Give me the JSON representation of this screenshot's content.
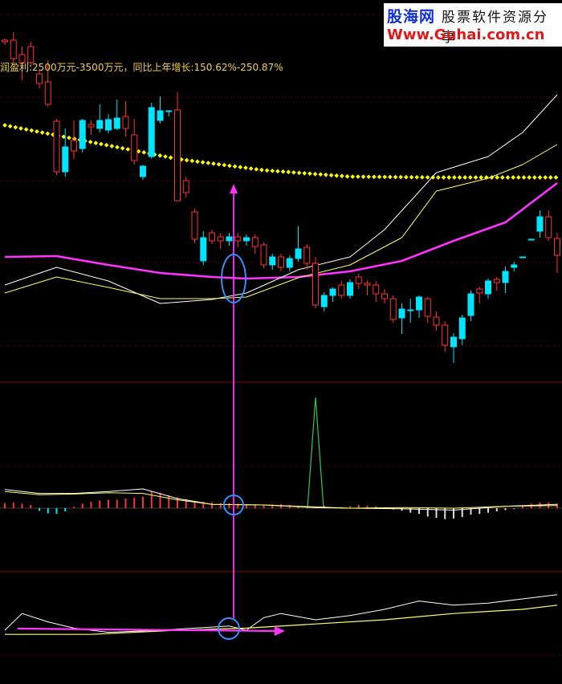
{
  "watermark": {
    "site_name": "股海网",
    "tagline": "股票软件资源分享",
    "url": "Www.Guhai.com.cn"
  },
  "info_text": "润盈利:2500万元-3500万元，同比上年增长:150.62%-250.87%",
  "colors": {
    "background": "#000000",
    "up_candle": "#ff3232",
    "down_candle": "#00e5ff",
    "ma_magenta": "#ff32ff",
    "ma_white": "#ffffff",
    "ma_yellow": "#ffff64",
    "dotted_line": "#ffff00",
    "annotation": "#ff32ff",
    "circle": "#3c8cff",
    "grid": "#8c0000"
  },
  "chart_data": [
    {
      "type": "candlestick",
      "panel": "price",
      "candles": [
        [
          0,
          318,
          297,
          290,
          340
        ],
        [
          1,
          296,
          270,
          262,
          300
        ],
        [
          2,
          270,
          288,
          262,
          296
        ],
        [
          3,
          298,
          298,
          298,
          298
        ],
        [
          4,
          320,
          320,
          320,
          320
        ],
        [
          5,
          330,
          333,
          326,
          338
        ],
        [
          6,
          338,
          352,
          332,
          365
        ],
        [
          7,
          352,
          348,
          345,
          362
        ],
        [
          8,
          350,
          366,
          347,
          372
        ],
        [
          9,
          365,
          360,
          357,
          378
        ],
        [
          10,
          366,
          393,
          362,
          400
        ],
        [
          11,
          396,
          422,
          392,
          430
        ],
        [
          12,
          420,
          432,
          415,
          452
        ],
        [
          13,
          430,
          405,
          400,
          438
        ],
        [
          14,
          405,
          395,
          388,
          412
        ],
        [
          15,
          394,
          372,
          370,
          402
        ],
        [
          16,
          370,
          386,
          368,
          396
        ],
        [
          17,
          386,
          386,
          372,
          402
        ],
        [
          18,
          385,
          396,
          378,
          416
        ],
        [
          19,
          398,
          372,
          368,
          402
        ],
        [
          20,
          372,
          366,
          360,
          378
        ],
        [
          21,
          366,
          355,
          350,
          376
        ],
        [
          22,
          355,
          353,
          349,
          368
        ],
        [
          23,
          353,
          345,
          341,
          360
        ],
        [
          24,
          352,
          368,
          348,
          372
        ],
        [
          25,
          368,
          355,
          350,
          372
        ],
        [
          26,
          360,
          368,
          358,
          376
        ],
        [
          27,
          368,
          382,
          364,
          388
        ],
        [
          28,
          380,
          328,
          320,
          384
        ],
        [
          29,
          328,
          308,
          304,
          336
        ],
        [
          30,
          310,
          322,
          282,
          326
        ],
        [
          31,
          322,
          333,
          318,
          338
        ],
        [
          32,
          333,
          320,
          316,
          338
        ],
        [
          33,
          320,
          330,
          316,
          336
        ],
        [
          34,
          330,
          305,
          302,
          334
        ],
        [
          35,
          307,
          296,
          292,
          316
        ],
        [
          36,
          296,
          300,
          292,
          306
        ],
        [
          37,
          300,
          295,
          290,
          308
        ],
        [
          38,
          295,
          300,
          290,
          306
        ],
        [
          39,
          300,
          295,
          290,
          310
        ],
        [
          40,
          300,
          290,
          286,
          304
        ],
        [
          41,
          296,
          325,
          288,
          330
        ],
        [
          42,
          298,
          264,
          260,
          303
        ],
        [
          43,
          240,
          225,
          220,
          246
        ],
        [
          44,
          250,
          137,
          115,
          150
        ],
        [
          45,
          138,
          138,
          138,
          145
        ],
        [
          46,
          138,
          150,
          120,
          154
        ],
        [
          47,
          134,
          195,
          128,
          198
        ],
        [
          48,
          207,
          220,
          205,
          224
        ],
        [
          49,
          200,
          168,
          148,
          205
        ],
        [
          50,
          160,
          145,
          126,
          170
        ],
        [
          51,
          147,
          160,
          124,
          162
        ],
        [
          52,
          149,
          162,
          142,
          166
        ],
        [
          53,
          150,
          160,
          130,
          165
        ],
        [
          54,
          158,
          155,
          150,
          168
        ],
        [
          55,
          150,
          185,
          148,
          190
        ],
        [
          56,
          188,
          175,
          150,
          198
        ],
        [
          57,
          183,
          214,
          160,
          220
        ],
        [
          58,
          214,
          151,
          148,
          218
        ],
        [
          59,
          130,
          102,
          75,
          133
        ],
        [
          60,
          104,
          92,
          87,
          110
        ],
        [
          61,
          78,
          58,
          52,
          82
        ],
        [
          62,
          78,
          68,
          58,
          100
        ],
        [
          63,
          73,
          50,
          40,
          78
        ],
        [
          64,
          52,
          50,
          48,
          56
        ]
      ],
      "ma_magenta": [
        [
          0,
          320
        ],
        [
          6,
          319
        ],
        [
          12,
          330
        ],
        [
          18,
          340
        ],
        [
          24,
          345
        ],
        [
          28,
          347
        ],
        [
          34,
          345
        ],
        [
          40,
          338
        ],
        [
          46,
          325
        ],
        [
          52,
          300
        ],
        [
          58,
          277
        ],
        [
          64,
          228
        ]
      ],
      "ma_white": [
        [
          0,
          355
        ],
        [
          6,
          333
        ],
        [
          12,
          350
        ],
        [
          18,
          378
        ],
        [
          24,
          373
        ],
        [
          28,
          365
        ],
        [
          34,
          336
        ],
        [
          40,
          320
        ],
        [
          44,
          286
        ],
        [
          50,
          215
        ],
        [
          56,
          195
        ],
        [
          60,
          165
        ],
        [
          64,
          118
        ]
      ],
      "ma_yellow": [
        [
          0,
          365
        ],
        [
          6,
          345
        ],
        [
          12,
          358
        ],
        [
          18,
          372
        ],
        [
          24,
          372
        ],
        [
          28,
          370
        ],
        [
          34,
          346
        ],
        [
          40,
          330
        ],
        [
          46,
          296
        ],
        [
          50,
          238
        ],
        [
          56,
          222
        ],
        [
          60,
          205
        ],
        [
          64,
          180
        ]
      ],
      "dotted": [
        [
          0,
          156
        ],
        [
          10,
          177
        ],
        [
          20,
          198
        ],
        [
          30,
          212
        ],
        [
          40,
          220
        ],
        [
          50,
          221
        ],
        [
          60,
          221
        ],
        [
          64,
          221
        ]
      ]
    },
    {
      "type": "bar",
      "panel": "macd",
      "histogram": [
        0.7,
        0.9,
        0.9,
        0.7,
        0.4,
        -0.1,
        -0.3,
        -0.5,
        -0.7,
        -0.9,
        -1.0,
        -1.4,
        -1.6,
        -1.7,
        -1.5,
        -1.3,
        -0.9,
        -0.7,
        -0.4,
        -0.2,
        0.1,
        0.3,
        0.4,
        0.5,
        0.3,
        0.2,
        0.1,
        0.4,
        0.1,
        0.3,
        0.4,
        0.5,
        0.6,
        0.6,
        0.5,
        0.5,
        0.6,
        0.7,
        0.8,
        0.8,
        0.9,
        1.0,
        1.1,
        1.4,
        1.7,
        2.0,
        2.4,
        2.6,
        1.8,
        1.6,
        1.5,
        1.3,
        1.3,
        1.2,
        1.0,
        0.7,
        0.2,
        -0.5,
        -0.9,
        -0.8,
        -0.4,
        0.5,
        0.7,
        0.9,
        0.8
      ],
      "spike_index": 28,
      "white_line": [
        [
          0,
          0.6
        ],
        [
          6,
          0.3
        ],
        [
          12,
          -0.3
        ],
        [
          18,
          -0.1
        ],
        [
          24,
          0.0
        ],
        [
          28,
          0.1
        ],
        [
          34,
          0.5
        ],
        [
          40,
          0.6
        ],
        [
          44,
          1.5
        ],
        [
          48,
          3.0
        ],
        [
          52,
          2.6
        ],
        [
          56,
          2.3
        ],
        [
          60,
          2.3
        ],
        [
          64,
          2.9
        ]
      ],
      "yellow_line": [
        [
          0,
          0.4
        ],
        [
          6,
          0.3
        ],
        [
          12,
          0.0
        ],
        [
          18,
          0.1
        ],
        [
          24,
          0.0
        ],
        [
          28,
          0.2
        ],
        [
          34,
          0.5
        ],
        [
          40,
          0.6
        ],
        [
          44,
          1.3
        ],
        [
          48,
          2.3
        ],
        [
          52,
          2.4
        ],
        [
          56,
          2.2
        ],
        [
          60,
          2.1
        ],
        [
          64,
          2.6
        ]
      ]
    },
    {
      "type": "line",
      "panel": "indicator",
      "white_line": [
        [
          0,
          0
        ],
        [
          2,
          8
        ],
        [
          5,
          4
        ],
        [
          8,
          1
        ],
        [
          12,
          -1
        ],
        [
          18,
          0
        ],
        [
          22,
          1
        ],
        [
          26,
          2
        ],
        [
          28,
          0
        ],
        [
          30,
          6
        ],
        [
          32,
          8
        ],
        [
          36,
          5
        ],
        [
          40,
          7
        ],
        [
          44,
          10
        ],
        [
          48,
          14
        ],
        [
          52,
          12
        ],
        [
          56,
          13
        ],
        [
          60,
          15
        ],
        [
          64,
          17
        ]
      ],
      "yellow_line": [
        [
          0,
          -2
        ],
        [
          10,
          -2
        ],
        [
          20,
          0
        ],
        [
          28,
          1
        ],
        [
          36,
          3
        ],
        [
          44,
          5
        ],
        [
          52,
          8
        ],
        [
          60,
          10
        ],
        [
          64,
          12
        ]
      ]
    }
  ]
}
